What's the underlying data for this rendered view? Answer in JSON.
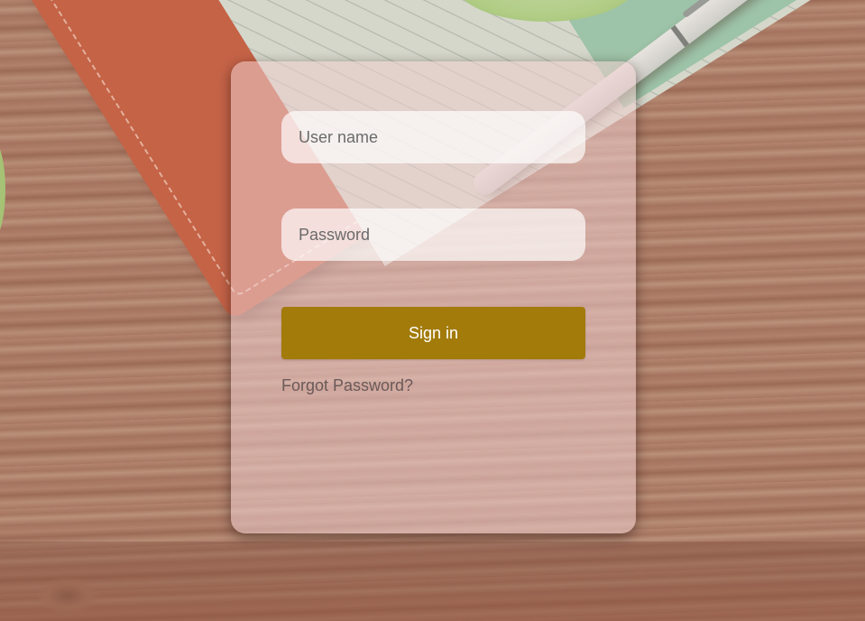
{
  "login": {
    "username_placeholder": "User name",
    "password_placeholder": "Password",
    "signin_label": "Sign in",
    "forgot_label": "Forgot Password?"
  },
  "colors": {
    "signin_button": "#a27b0a",
    "card_background": "rgba(238,206,206,0.55)"
  }
}
